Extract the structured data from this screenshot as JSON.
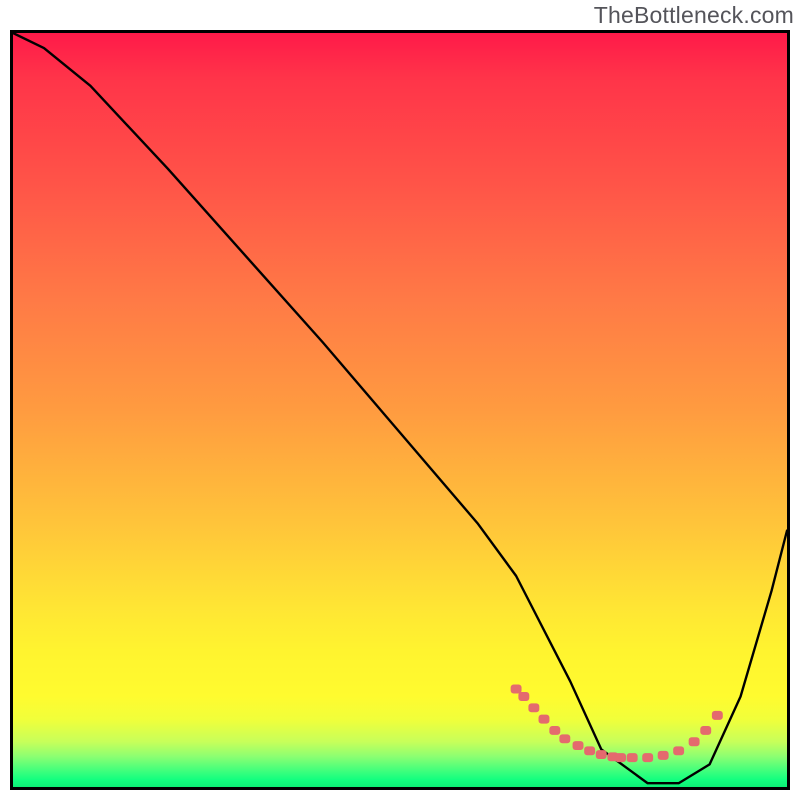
{
  "watermark": "TheBottleneck.com",
  "chart_data": {
    "type": "line",
    "title": "",
    "xlabel": "",
    "ylabel": "",
    "xlim": [
      0,
      100
    ],
    "ylim": [
      0,
      100
    ],
    "series": [
      {
        "name": "main-curve",
        "x": [
          0,
          4,
          10,
          20,
          30,
          40,
          50,
          60,
          65,
          68,
          72,
          76,
          82,
          86,
          90,
          94,
          98,
          100
        ],
        "y": [
          100,
          98,
          93,
          82,
          70.5,
          59,
          47,
          35,
          28,
          22,
          14,
          5,
          0.5,
          0.5,
          3,
          12,
          26,
          34
        ]
      },
      {
        "name": "dotted-valley-marker",
        "x": [
          65,
          66,
          67.3,
          68.6,
          70,
          71.3,
          73,
          74.5,
          76,
          77.5,
          78.5,
          80,
          82,
          84,
          86,
          88,
          89.5,
          91
        ],
        "y": [
          13,
          12,
          10.5,
          9.0,
          7.5,
          6.4,
          5.5,
          4.8,
          4.3,
          4.0,
          3.9,
          3.9,
          3.9,
          4.2,
          4.8,
          6.0,
          7.5,
          9.5
        ]
      }
    ],
    "gradient": {
      "direction": "vertical",
      "stops": [
        {
          "pos": 0.0,
          "color": "#ff1a49"
        },
        {
          "pos": 0.2,
          "color": "#ff5448"
        },
        {
          "pos": 0.5,
          "color": "#ff9b40"
        },
        {
          "pos": 0.76,
          "color": "#ffe534"
        },
        {
          "pos": 0.91,
          "color": "#f1ff3a"
        },
        {
          "pos": 0.98,
          "color": "#3aff7d"
        },
        {
          "pos": 1.0,
          "color": "#0dee75"
        }
      ]
    }
  }
}
